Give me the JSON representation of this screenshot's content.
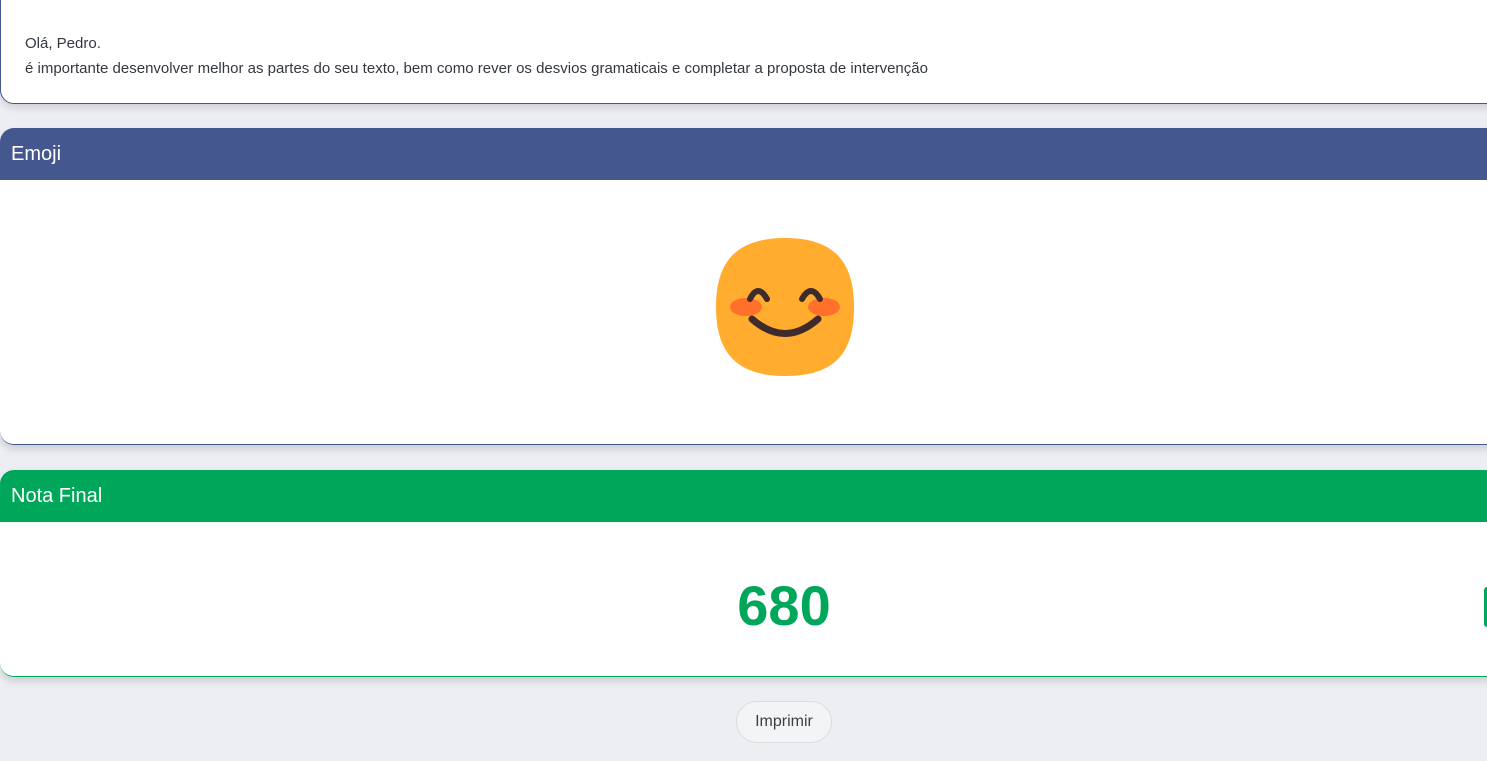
{
  "message": {
    "greeting": "Olá, Pedro.",
    "feedback": "é importante desenvolver melhor as partes do seu texto, bem como rever os desvios gramaticais e completar a proposta de intervenção"
  },
  "emoji_panel": {
    "title": "Emoji",
    "emoji_icon": "smiling-face-with-smiling-eyes-icon",
    "header_color": "#44578f"
  },
  "score_panel": {
    "title": "Nota Final",
    "value": "680",
    "header_color": "#00a65a"
  },
  "actions": {
    "print_label": "Imprimir"
  }
}
